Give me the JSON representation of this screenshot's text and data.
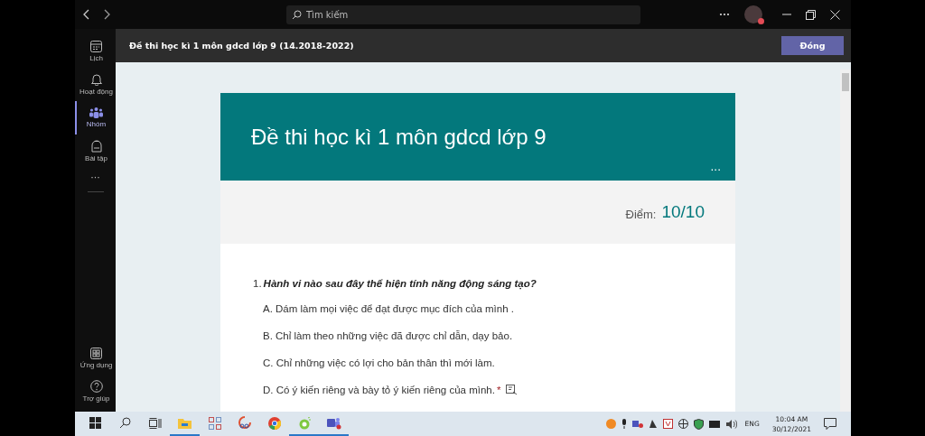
{
  "titlebar": {
    "search": {
      "placeholder": "Tìm kiếm"
    }
  },
  "rail": {
    "items": [
      {
        "label": "Lịch",
        "kind": "calendar",
        "selected": false
      },
      {
        "label": "Hoạt động",
        "kind": "bell",
        "selected": false
      },
      {
        "label": "Nhóm",
        "kind": "teams",
        "selected": true
      },
      {
        "label": "Bài tập",
        "kind": "backpack",
        "selected": false
      }
    ],
    "more": "···",
    "bottom": [
      {
        "label": "Ứng dụng",
        "kind": "apps",
        "selected": false
      },
      {
        "label": "Trợ giúp",
        "kind": "help",
        "selected": false
      }
    ]
  },
  "header": {
    "title": "Đề thi học kì 1 môn gdcd lớp 9 (14.2018-2022)",
    "button": "Đóng"
  },
  "form": {
    "title": "Đề thi học kì 1 môn gdcd lớp 9",
    "more": "···",
    "score_label": "Điểm:",
    "score": "10/10",
    "question": {
      "number": "1.",
      "text": "Hành vi nào sau đây thể hiện tính năng động sáng tạo?",
      "required_mark": "*",
      "options": [
        "A. Dám làm mọi việc để đạt được mục đích của mình .",
        "B. Chỉ làm theo những việc đã được chỉ dẫn, dạy bảo.",
        "C. Chỉ những việc có lợi cho bản thân thì mới làm.",
        "D. Có ý kiến riêng và bày tỏ ý kiến riêng của mình."
      ]
    }
  },
  "taskbar": {
    "apps": [
      {
        "kind": "start",
        "active": false
      },
      {
        "kind": "search",
        "active": false
      },
      {
        "kind": "taskview",
        "active": false
      },
      {
        "kind": "folder",
        "active": true
      },
      {
        "kind": "grid",
        "active": false
      },
      {
        "kind": "snip",
        "active": false
      },
      {
        "kind": "chrome",
        "active": false
      },
      {
        "kind": "green",
        "active": true
      },
      {
        "kind": "teams",
        "active": true
      }
    ],
    "language": "ENG",
    "time": "10:04 AM",
    "date": "30/12/2021"
  }
}
